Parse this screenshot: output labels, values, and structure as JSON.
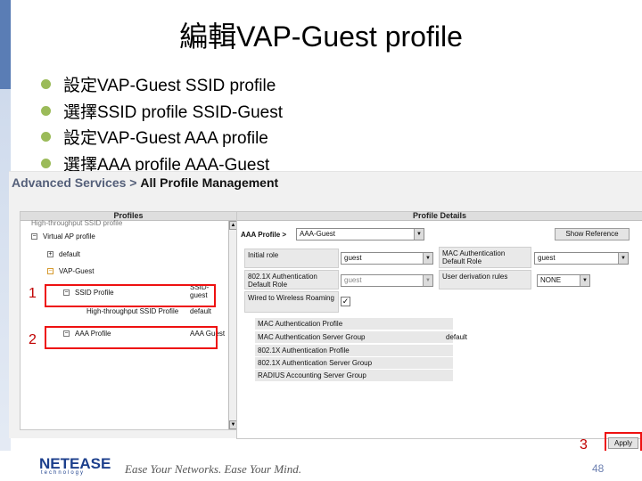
{
  "slide": {
    "title": "編輯VAP-Guest profile",
    "bullets": [
      "設定VAP-Guest  SSID profile",
      "選擇SSID profile  SSID-Guest",
      "設定VAP-Guest  AAA profile",
      "選擇AAA profile  AAA-Guest"
    ]
  },
  "screenshot": {
    "breadcrumb_prefix": "Advanced Services > ",
    "breadcrumb_current": "All Profile Management",
    "profiles_header": "Profiles",
    "details_header": "Profile Details",
    "tree": {
      "ht_top": "High-throughput SSID profile",
      "virtual_ap": "Virtual AP profile",
      "default": "default",
      "vap_guest": "VAP-Guest",
      "ssid_profile": "SSID Profile",
      "ssid_value": "SSID-guest",
      "ht_ssid": "High-throughput SSID Profile",
      "ht_value": "default",
      "aaa_profile": "AAA Profile",
      "aaa_value": "AAA Guest"
    },
    "details": {
      "aaa_profile_label": "AAA Profile >",
      "aaa_profile_value": "AAA-Guest",
      "show_reference": "Show Reference",
      "initial_role_label": "Initial role",
      "initial_role_value": "guest",
      "mac_auth_default_role_label": "MAC Authentication Default Role",
      "mac_auth_default_role_value": "guest",
      "dot1x_default_role_label": "802.1X Authentication Default Role",
      "dot1x_default_role_value": "guest",
      "user_derivation_label": "User derivation rules",
      "user_derivation_value": "NONE",
      "wired_roaming_label": "Wired to Wireless Roaming",
      "wired_roaming_checked": "✓",
      "sub_profiles": [
        "MAC Authentication Profile",
        "MAC Authentication Server Group",
        "802.1X Authentication Profile",
        "802.1X Authentication Server Group",
        "RADIUS Accounting Server Group"
      ],
      "server_group_value": "default"
    },
    "apply_label": "Apply",
    "markers": [
      "1",
      "2",
      "3"
    ]
  },
  "footer": {
    "logo": "NETEASE",
    "logo_sub": "technology",
    "slogan": "Ease Your Networks. Ease Your Mind.",
    "page_number": "48"
  },
  "colors": {
    "bullet": "#9bbb59",
    "highlight": "#ee1111",
    "marker": "#c00000",
    "side_bar": "#c9d6ea"
  }
}
